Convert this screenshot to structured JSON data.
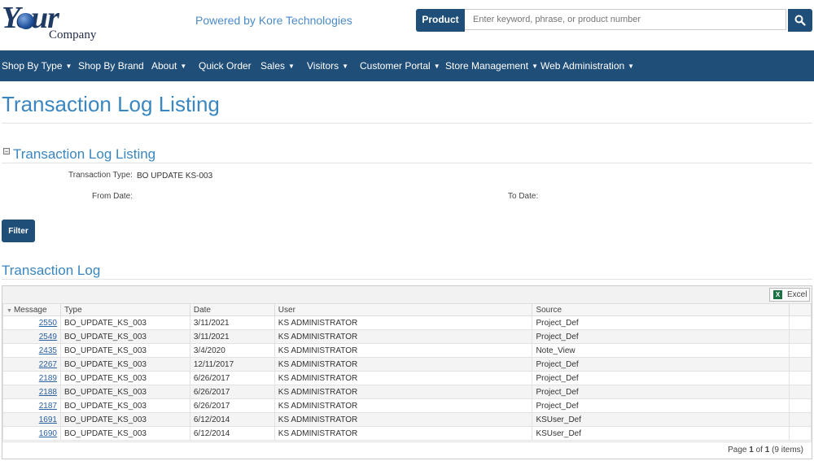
{
  "header": {
    "logo_your": "Your",
    "logo_company": "Company",
    "powered_by": "Powered by Kore Technologies"
  },
  "search": {
    "category": "Product",
    "placeholder": "Enter keyword, phrase, or product number"
  },
  "nav": {
    "items": [
      {
        "label": "Shop By Type",
        "has_caret": true
      },
      {
        "label": "Shop By Brand",
        "has_caret": false
      },
      {
        "label": "About",
        "has_caret": true
      },
      {
        "label": "Quick Order",
        "has_caret": false
      },
      {
        "label": "Sales",
        "has_caret": true
      },
      {
        "label": "Visitors",
        "has_caret": true
      },
      {
        "label": "Customer Portal",
        "has_caret": true
      },
      {
        "label": "Store Management",
        "has_caret": true
      },
      {
        "label": "Web Administration",
        "has_caret": true
      }
    ]
  },
  "page": {
    "title": "Transaction Log Listing"
  },
  "filter_section": {
    "title": "Transaction Log Listing",
    "transaction_type_label": "Transaction Type:",
    "transaction_type_value": "BO UPDATE KS-003",
    "from_date_label": "From Date:",
    "to_date_label": "To Date:",
    "filter_button": "Filter"
  },
  "log": {
    "title": "Transaction Log",
    "excel_label": "Excel",
    "columns": [
      "Message",
      "Type",
      "Date",
      "User",
      "Source"
    ],
    "rows": [
      {
        "message": "2550",
        "type": "BO_UPDATE_KS_003",
        "date": "3/11/2021",
        "user": "KS ADMINISTRATOR",
        "source": "Project_Def"
      },
      {
        "message": "2549",
        "type": "BO_UPDATE_KS_003",
        "date": "3/11/2021",
        "user": "KS ADMINISTRATOR",
        "source": "Project_Def"
      },
      {
        "message": "2435",
        "type": "BO_UPDATE_KS_003",
        "date": "3/4/2020",
        "user": "KS ADMINISTRATOR",
        "source": "Note_View"
      },
      {
        "message": "2267",
        "type": "BO_UPDATE_KS_003",
        "date": "12/11/2017",
        "user": "KS ADMINISTRATOR",
        "source": "Project_Def"
      },
      {
        "message": "2189",
        "type": "BO_UPDATE_KS_003",
        "date": "6/26/2017",
        "user": "KS ADMINISTRATOR",
        "source": "Project_Def"
      },
      {
        "message": "2188",
        "type": "BO_UPDATE_KS_003",
        "date": "6/26/2017",
        "user": "KS ADMINISTRATOR",
        "source": "Project_Def"
      },
      {
        "message": "2187",
        "type": "BO_UPDATE_KS_003",
        "date": "6/26/2017",
        "user": "KS ADMINISTRATOR",
        "source": "Project_Def"
      },
      {
        "message": "1691",
        "type": "BO_UPDATE_KS_003",
        "date": "6/12/2014",
        "user": "KS ADMINISTRATOR",
        "source": "KSUser_Def"
      },
      {
        "message": "1690",
        "type": "BO_UPDATE_KS_003",
        "date": "6/12/2014",
        "user": "KS ADMINISTRATOR",
        "source": "KSUser_Def"
      }
    ],
    "pager": {
      "prefix": "Page",
      "current": "1",
      "of": "of",
      "total": "1",
      "items": "(9 items)"
    }
  },
  "colors": {
    "brand_blue": "#1f4e79",
    "title_blue": "#3a86c0",
    "link_blue": "#2a5fa0"
  }
}
